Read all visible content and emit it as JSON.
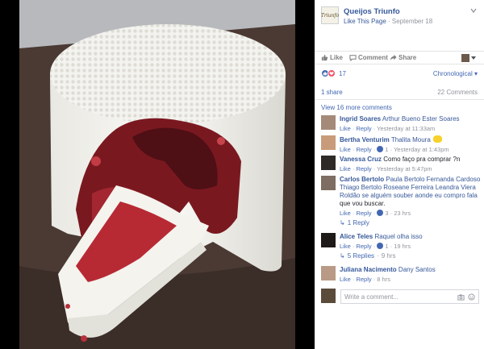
{
  "post": {
    "page_name": "Queijos Triunfo",
    "like_page": "Like This Page",
    "date": "September 18"
  },
  "actions": {
    "like": "Like",
    "comment": "Comment",
    "share": "Share"
  },
  "reactions": {
    "count": "17",
    "order": "Chronological"
  },
  "stats": {
    "shares": "1 share",
    "comments": "22 Comments"
  },
  "view_more": "View 16 more comments",
  "comments": [
    {
      "author": "Ingrid Soares",
      "text": "Arthur Bueno Ester Soares",
      "like": "Like",
      "reply": "Reply",
      "time": "Yesterday at 11:33am"
    },
    {
      "author": "Bertha Venturim",
      "text": "Thalita Moura",
      "like": "Like",
      "reply": "Reply",
      "likes": "1",
      "time": "Yesterday at 1:43pm"
    },
    {
      "author": "Vanessa Cruz",
      "text": "Como faço pra comprar ?n",
      "like": "Like",
      "reply": "Reply",
      "time": "Yesterday at 5:47pm"
    },
    {
      "author": "Carlos Bertolo",
      "text_line1": "Paula Bertolo Fernanda Cardoso",
      "text_line2": "Thiago Bertolo Roseane Ferreira Leandra Viera",
      "text_line3": "Roldão se alguém souber aonde eu compro fala",
      "text_line4": "que vou buscar.",
      "like": "Like",
      "reply": "Reply",
      "likes": "3",
      "time": "23 hrs",
      "replies": "1 Reply"
    },
    {
      "author": "Alice Teles",
      "text": "Raquel olha isso",
      "like": "Like",
      "reply": "Reply",
      "likes": "1",
      "time": "19 hrs",
      "replies": "5 Replies",
      "replies_time": "9 hrs"
    },
    {
      "author": "Juliana Nacimento",
      "text": "Dany Santos",
      "like": "Like",
      "reply": "Reply",
      "time": "8 hrs"
    }
  ],
  "write": {
    "placeholder": "Write a comment..."
  },
  "colors": {
    "link": "#365899",
    "accent": "#4267b2",
    "muted": "#90949c"
  }
}
